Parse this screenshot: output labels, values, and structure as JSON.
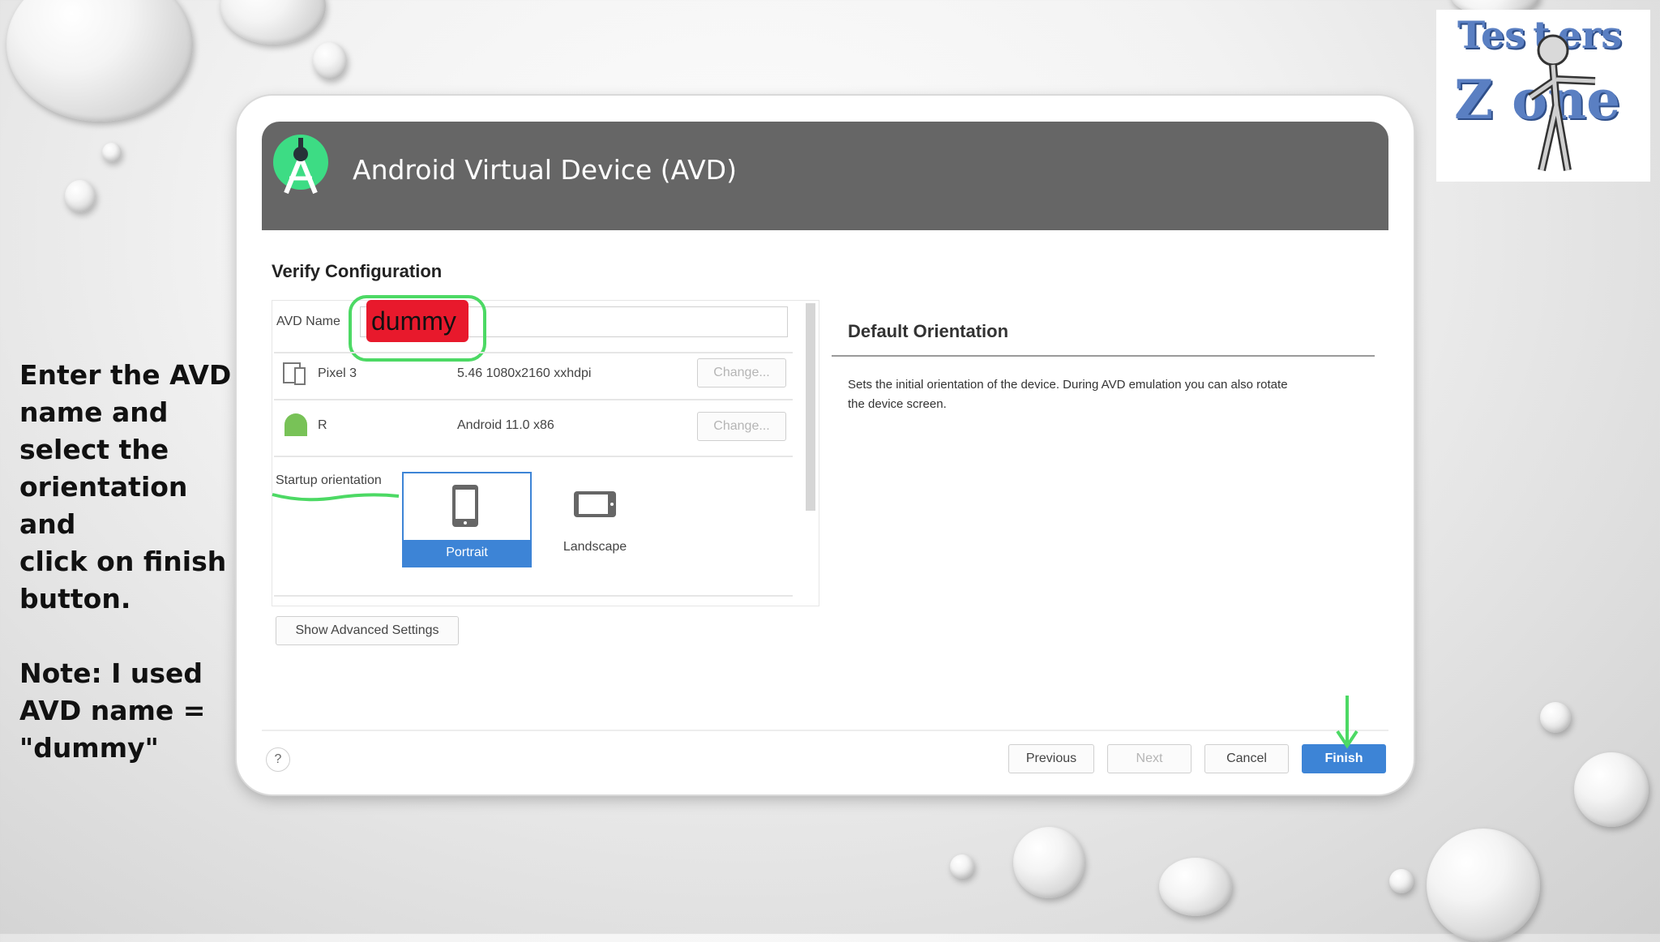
{
  "instructions": {
    "line1": "Enter the AVD",
    "line2": "name and",
    "line3": "select the",
    "line4": "orientation and",
    "line5": "click on finish",
    "line6": "button.",
    "note1": "Note: I used",
    "note2": "AVD name =",
    "note3": "\"dummy\""
  },
  "logo": {
    "line1": "Tes t ers",
    "line2": "Z   one"
  },
  "window": {
    "title": "Android Virtual Device (AVD)",
    "section_title": "Verify Configuration",
    "avd_name_label": "AVD Name",
    "avd_name_value": "dummy",
    "device": {
      "name": "Pixel 3",
      "spec": "5.46 1080x2160 xxhdpi",
      "change_label": "Change..."
    },
    "system_image": {
      "name": "R",
      "spec": "Android 11.0 x86",
      "change_label": "Change..."
    },
    "startup_orientation_label": "Startup orientation",
    "orientation": {
      "portrait_label": "Portrait",
      "landscape_label": "Landscape",
      "selected": "Portrait"
    },
    "advanced_button": "Show Advanced Settings",
    "help_heading": "Default Orientation",
    "help_line1": "Sets the initial orientation of the device. During AVD emulation you can also rotate",
    "help_line2": "the device screen.",
    "help_icon": "?",
    "buttons": {
      "previous": "Previous",
      "next": "Next",
      "cancel": "Cancel",
      "finish": "Finish"
    }
  },
  "colors": {
    "header": "#666666",
    "accent": "#3d84d6",
    "highlight": "#e8192c",
    "annotation": "#4cd964"
  }
}
